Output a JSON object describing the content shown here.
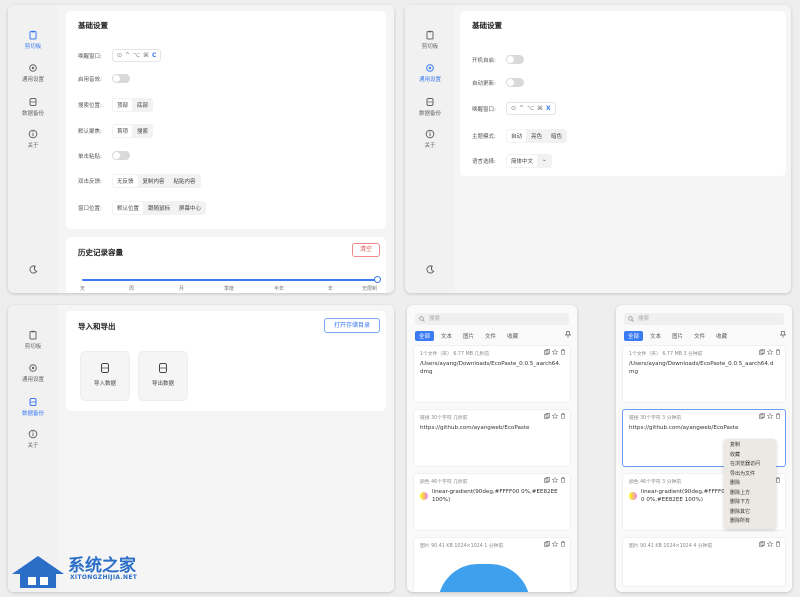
{
  "colors": {
    "accent": "#3b7bf3",
    "danger": "#e05555",
    "dot_red": "#fe5f57",
    "dot_yellow": "#febc2e",
    "dot_green": "#28c840"
  },
  "nav": {
    "clipboard": "剪切板",
    "general": "通用设置",
    "backup": "数据备份",
    "about": "关于"
  },
  "clip_settings": {
    "title": "基础设置",
    "window_shortcut_label": "唤醒窗口:",
    "shortcut_keys": [
      "⊙",
      "^",
      "⌥",
      "⌘",
      "C"
    ],
    "sound_label": "启用音效:",
    "search_pos_label": "搜索位置:",
    "search_pos_options": [
      "顶部",
      "底部"
    ],
    "default_focus_label": "默认聚焦:",
    "default_focus_options": [
      "首项",
      "搜索"
    ],
    "single_click_label": "单击粘贴:",
    "double_click_label": "双击反馈:",
    "double_click_options": [
      "无反馈",
      "复制内容",
      "粘贴内容"
    ],
    "window_pos_label": "窗口位置:",
    "window_pos_options": [
      "默认位置",
      "跟随鼠标",
      "屏幕中心"
    ],
    "history_title": "历史记录容量",
    "clear_label": "清空",
    "ticks": [
      "天",
      "周",
      "月",
      "季度",
      "半年",
      "年",
      "无限制"
    ]
  },
  "general_settings": {
    "title": "基础设置",
    "autostart_label": "开机自启:",
    "autoupdate_label": "自动更新:",
    "window_shortcut_label": "唤醒窗口:",
    "shortcut_keys": [
      "⊙",
      "^",
      "⌥",
      "⌘",
      "X"
    ],
    "theme_label": "主题模式:",
    "theme_options": [
      "自动",
      "亮色",
      "暗色"
    ],
    "lang_label": "语言选择:",
    "lang_value": "简体中文",
    "lang_caret": "⌄"
  },
  "backup": {
    "title": "导入和导出",
    "open_dir_label": "打开存储目录",
    "import_label": "导入数据",
    "export_label": "导出数据"
  },
  "clip_list": {
    "search_placeholder": "搜索",
    "tabs": [
      "全部",
      "文本",
      "图片",
      "文件",
      "收藏"
    ],
    "items": [
      {
        "meta": "1个文件（夹）  6.77 MB  几秒前",
        "content": "/Users/ayang/Downloads/EcoPaste_0.0.5_aarch64.dmg"
      },
      {
        "meta": "链接  30个字符  几秒前",
        "content": "https://github.com/ayangweb/EcoPaste"
      },
      {
        "meta": "颜色  46个字符  几秒前",
        "content": "linear-gradient(90deg,#FFFF00 0%,#EE82EE 100%)"
      },
      {
        "meta": "图片  90.41 KB  1024×1024  1 分钟前",
        "content": ""
      }
    ]
  },
  "clip_list_2": {
    "search_placeholder": "搜索",
    "tabs": [
      "全部",
      "文本",
      "图片",
      "文件",
      "收藏"
    ],
    "items": [
      {
        "meta": "1个文件（夹）  6.77 MB  3 分钟前",
        "content": "/Users/ayang/Downloads/EcoPaste_0.0.5_aarch64.dmg"
      },
      {
        "meta": "链接  30个字符  3 分钟前",
        "content": "https://github.com/ayangweb/EcoPaste"
      },
      {
        "meta": "颜色  46个字符  3 分钟前",
        "content": "linear-gradient(90deg,#FFFF00 0%,#EE82EE 100%)"
      },
      {
        "meta": "图片  90.41 KB  1024×1024  4 分钟前",
        "content": ""
      }
    ],
    "context_menu": [
      "复制",
      "收藏",
      "在浏览器访问",
      "导出为文件",
      "删除",
      "删除上方",
      "删除下方",
      "删除其它",
      "删除所有"
    ]
  },
  "watermark": {
    "title": "系统之家",
    "subtitle": "XITONGZHIJIA.NET"
  }
}
